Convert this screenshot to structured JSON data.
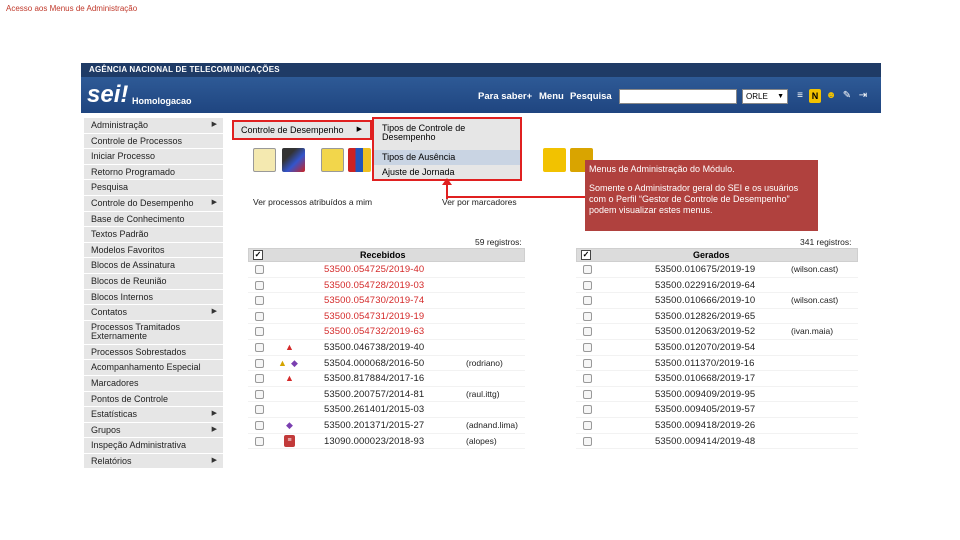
{
  "slide": {
    "title": "Acesso aos Menus de Administração"
  },
  "app": {
    "agency": "AGÊNCIA NACIONAL DE TELECOMUNICAÇÕES",
    "logo": "sei!",
    "environment": "Homologacao",
    "header_links": [
      "Para saber+",
      "Menu",
      "Pesquisa"
    ],
    "search": {
      "value": "",
      "placeholder": ""
    },
    "unit": "ORLE"
  },
  "sidebar": {
    "items": [
      {
        "label": "Administração",
        "submenu": true
      },
      {
        "label": "Controle de Processos",
        "submenu": false
      },
      {
        "label": "Iniciar Processo",
        "submenu": false
      },
      {
        "label": "Retorno Programado",
        "submenu": false
      },
      {
        "label": "Pesquisa",
        "submenu": false
      },
      {
        "label": "Controle do Desempenho",
        "submenu": true
      },
      {
        "label": "Base de Conhecimento",
        "submenu": false
      },
      {
        "label": "Textos Padrão",
        "submenu": false
      },
      {
        "label": "Modelos Favoritos",
        "submenu": false
      },
      {
        "label": "Blocos de Assinatura",
        "submenu": false
      },
      {
        "label": "Blocos de Reunião",
        "submenu": false
      },
      {
        "label": "Blocos Internos",
        "submenu": false
      },
      {
        "label": "Contatos",
        "submenu": true
      },
      {
        "label": "Processos Tramitados Externamente",
        "submenu": false
      },
      {
        "label": "Processos Sobrestados",
        "submenu": false
      },
      {
        "label": "Acompanhamento Especial",
        "submenu": false
      },
      {
        "label": "Marcadores",
        "submenu": false
      },
      {
        "label": "Pontos de Controle",
        "submenu": false
      },
      {
        "label": "Estatísticas",
        "submenu": true
      },
      {
        "label": "Grupos",
        "submenu": true
      },
      {
        "label": "Inspeção Administrativa",
        "submenu": false
      },
      {
        "label": "Relatórios",
        "submenu": true
      }
    ]
  },
  "submenu": {
    "label": "Controle de Desempenho"
  },
  "submenu2": {
    "items": [
      "Tipos de Controle de Desempenho",
      "Tipos de Ausência",
      "Ajuste de Jornada"
    ]
  },
  "callout": {
    "line1": "Menus de Administração do Módulo.",
    "line2": "Somente o Administrador geral do SEI e os usuários com o Perfil “Gestor de Controle de Desempenho” podem visualizar estes menus."
  },
  "filters": {
    "left": "Ver processos atribuídos a mim",
    "right": "Ver por marcadores"
  },
  "received": {
    "count": "59 registros:",
    "header": "Recebidos",
    "rows": [
      {
        "proc": "53500.054725/2019-40",
        "color": "#d42a2a",
        "icons": [],
        "user": ""
      },
      {
        "proc": "53500.054728/2019-03",
        "color": "#d42a2a",
        "icons": [],
        "user": ""
      },
      {
        "proc": "53500.054730/2019-74",
        "color": "#d42a2a",
        "icons": [],
        "user": ""
      },
      {
        "proc": "53500.054731/2019-19",
        "color": "#d42a2a",
        "icons": [],
        "user": ""
      },
      {
        "proc": "53500.054732/2019-63",
        "color": "#d42a2a",
        "icons": [],
        "user": ""
      },
      {
        "proc": "53500.046738/2019-40",
        "color": "#222222",
        "icons": [
          "alert-red"
        ],
        "user": ""
      },
      {
        "proc": "53504.000068/2016-50",
        "color": "#222222",
        "icons": [
          "alert-yellow",
          "tag-purple"
        ],
        "user": "(rodriano)"
      },
      {
        "proc": "53500.817884/2017-16",
        "color": "#222222",
        "icons": [
          "alert-red"
        ],
        "user": ""
      },
      {
        "proc": "53500.200757/2014-81",
        "color": "#222222",
        "icons": [],
        "user": "(raul.ittg)"
      },
      {
        "proc": "53500.261401/2015-03",
        "color": "#222222",
        "icons": [],
        "user": ""
      },
      {
        "proc": "53500.201371/2015-27",
        "color": "#222222",
        "icons": [
          "tag-purple"
        ],
        "user": "(adnand.lima)"
      },
      {
        "proc": "13090.000023/2018-93",
        "color": "#222222",
        "icons": [
          "note-red"
        ],
        "user": "(alopes)"
      }
    ]
  },
  "generated": {
    "count": "341 registros:",
    "header": "Gerados",
    "rows": [
      {
        "proc": "53500.010675/2019-19",
        "user": "(wilson.cast)"
      },
      {
        "proc": "53500.022916/2019-64",
        "user": ""
      },
      {
        "proc": "53500.010666/2019-10",
        "user": "(wilson.cast)"
      },
      {
        "proc": "53500.012826/2019-65",
        "user": ""
      },
      {
        "proc": "53500.012063/2019-52",
        "user": "(ivan.maia)"
      },
      {
        "proc": "53500.012070/2019-54",
        "user": ""
      },
      {
        "proc": "53500.011370/2019-16",
        "user": ""
      },
      {
        "proc": "53500.010668/2019-17",
        "user": ""
      },
      {
        "proc": "53500.009409/2019-95",
        "user": ""
      },
      {
        "proc": "53500.009405/2019-57",
        "user": ""
      },
      {
        "proc": "53500.009418/2019-26",
        "user": ""
      },
      {
        "proc": "53500.009414/2019-48",
        "user": ""
      }
    ]
  }
}
